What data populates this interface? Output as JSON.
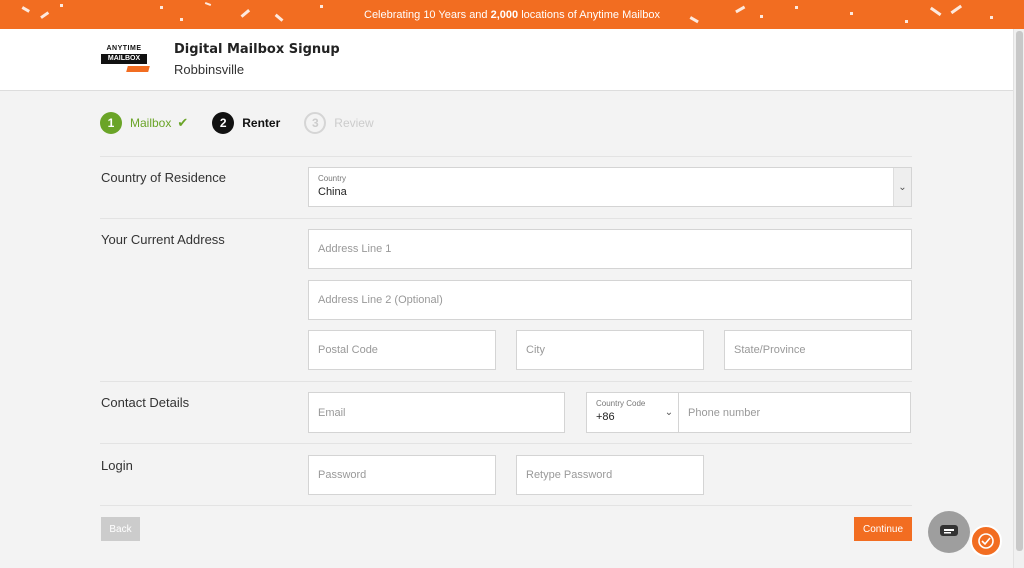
{
  "banner": {
    "pre": "Celebrating 10 Years and ",
    "bold": "2,000",
    "post": " locations of Anytime Mailbox"
  },
  "header": {
    "logo_line1": "ANYTIME",
    "logo_line2": "MAILBOX",
    "title": "Digital Mailbox Signup",
    "location": "Robbinsville"
  },
  "steps": [
    {
      "num": "1",
      "label": "Mailbox",
      "state": "done"
    },
    {
      "num": "2",
      "label": "Renter",
      "state": "active"
    },
    {
      "num": "3",
      "label": "Review",
      "state": "todo"
    }
  ],
  "sections": {
    "country": {
      "label": "Country of Residence",
      "field_caption": "Country",
      "value": "China"
    },
    "address": {
      "label": "Your Current Address",
      "line1_placeholder": "Address Line 1",
      "line2_placeholder": "Address Line 2 (Optional)",
      "postal_placeholder": "Postal Code",
      "city_placeholder": "City",
      "state_placeholder": "State/Province"
    },
    "contact": {
      "label": "Contact Details",
      "email_placeholder": "Email",
      "country_code_caption": "Country Code",
      "country_code_value": "+86",
      "phone_placeholder": "Phone number"
    },
    "login": {
      "label": "Login",
      "password_placeholder": "Password",
      "retype_placeholder": "Retype Password"
    }
  },
  "actions": {
    "back": "Back",
    "continue": "Continue"
  },
  "colors": {
    "accent": "#f26d21",
    "success": "#6aa427"
  },
  "icons": {
    "chat": "chat-bubble-icon",
    "help": "help-support-icon",
    "check": "checkmark-icon",
    "dropdown": "chevron-down-icon"
  }
}
